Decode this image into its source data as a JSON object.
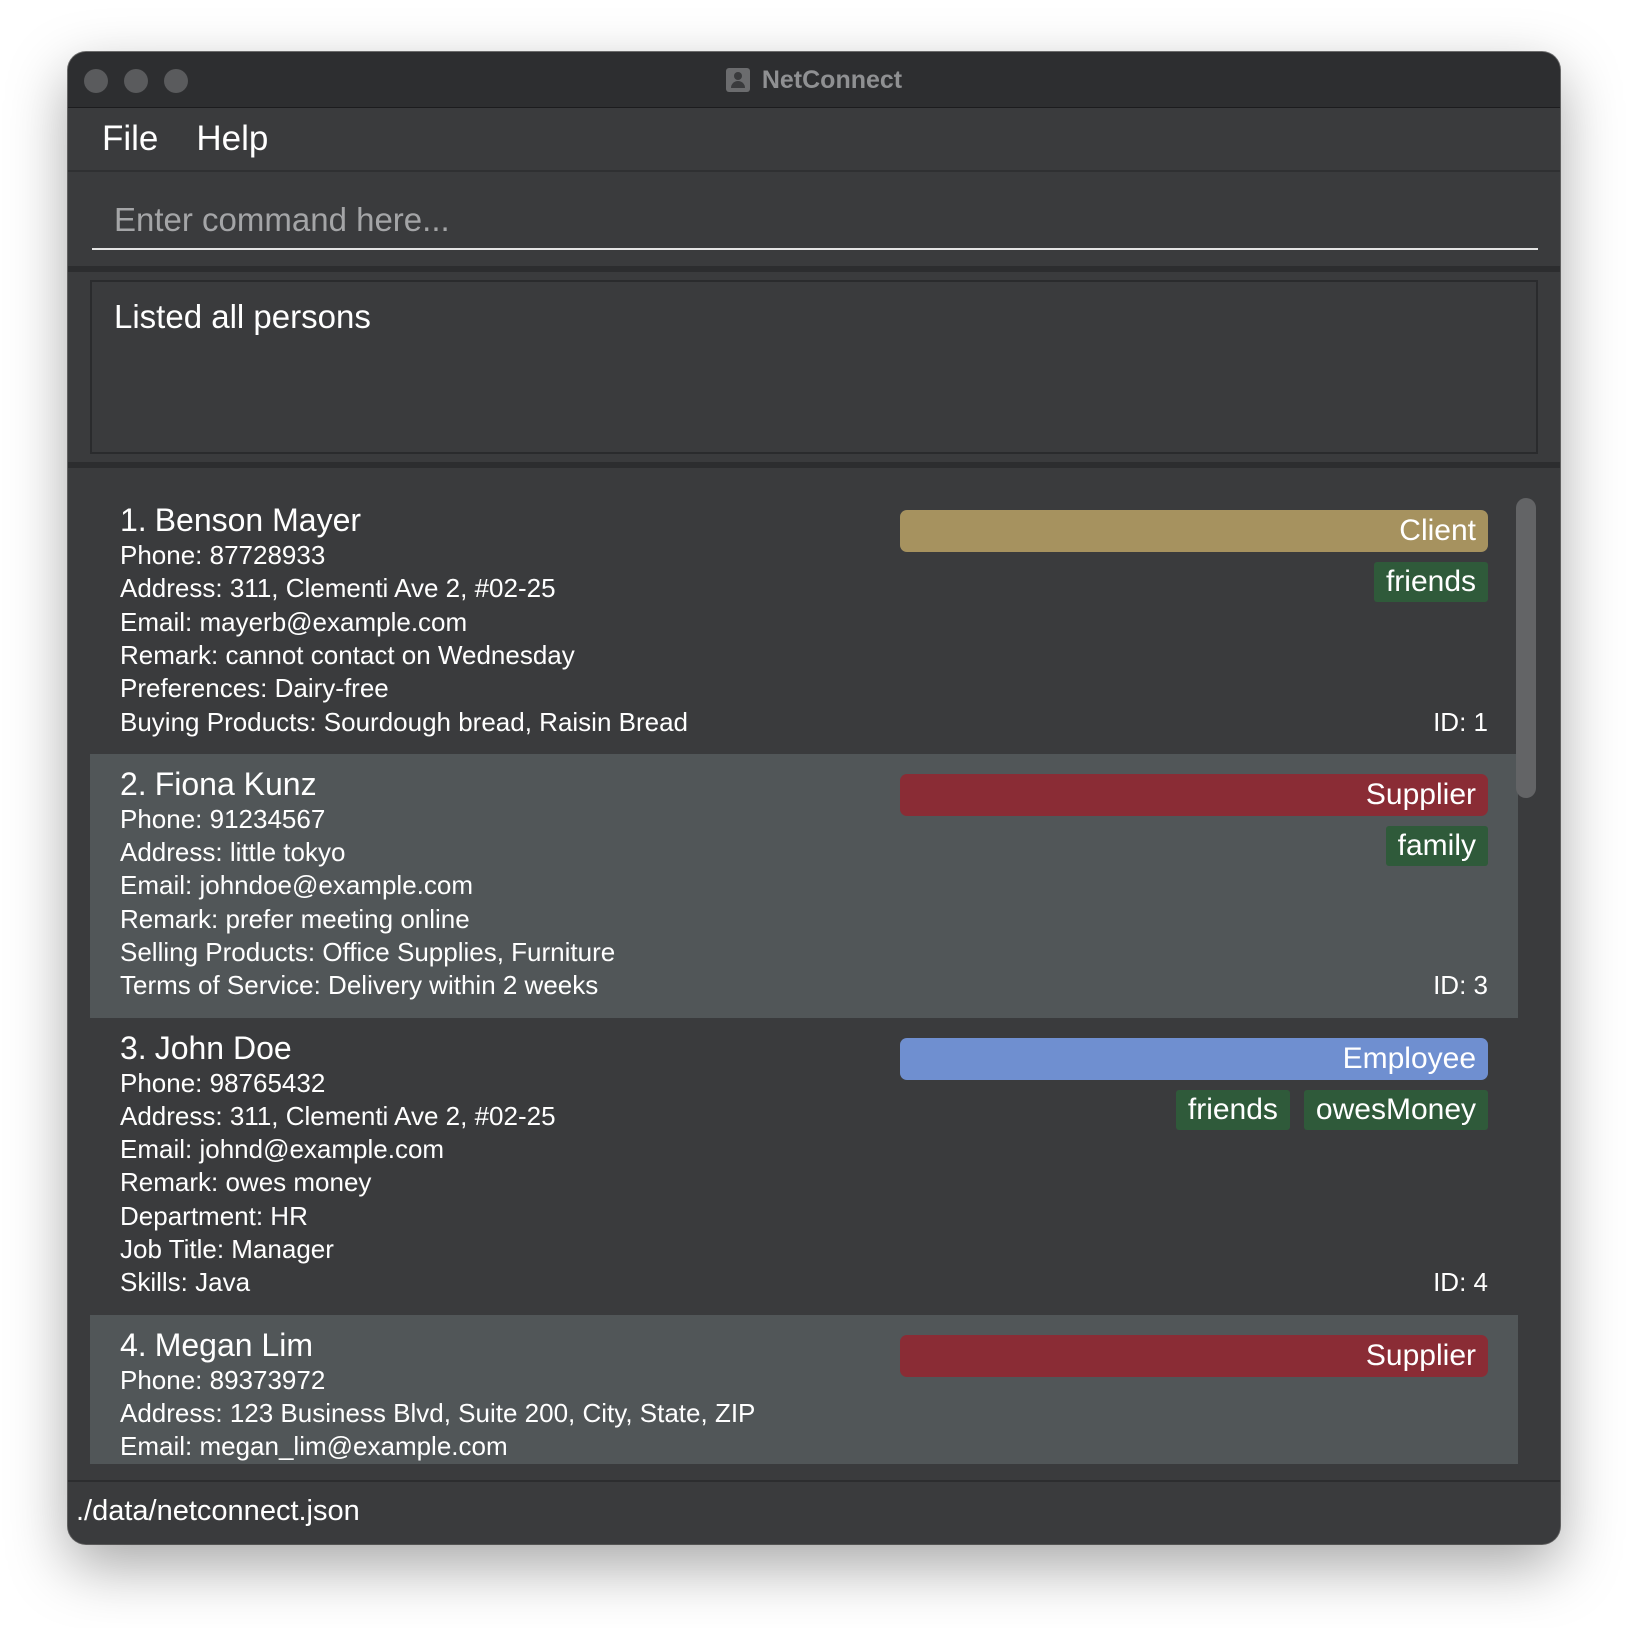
{
  "window": {
    "title": "NetConnect",
    "app_icon": "contact-card-icon"
  },
  "menu": {
    "file": "File",
    "help": "Help"
  },
  "command": {
    "placeholder": "Enter command here...",
    "value": ""
  },
  "result": {
    "message": "Listed all persons"
  },
  "colors": {
    "client": "#a6925f",
    "supplier": "#8a2c35",
    "employee": "#6f8fd0",
    "tag": "#2f5a3a"
  },
  "persons": [
    {
      "index": "1.",
      "name": "Benson Mayer",
      "role": "Client",
      "tags": [
        "friends"
      ],
      "fields": [
        "Phone: 87728933",
        "Address: 311, Clementi Ave 2, #02-25",
        "Email: mayerb@example.com",
        "Remark: cannot contact on Wednesday",
        "Preferences: Dairy-free",
        "Buying Products: Sourdough bread, Raisin Bread"
      ],
      "id": "ID: 1"
    },
    {
      "index": "2.",
      "name": "Fiona Kunz",
      "role": "Supplier",
      "tags": [
        "family"
      ],
      "fields": [
        "Phone: 91234567",
        "Address: little tokyo",
        "Email: johndoe@example.com",
        "Remark: prefer meeting online",
        "Selling Products: Office Supplies, Furniture",
        "Terms of Service: Delivery within 2 weeks"
      ],
      "id": "ID: 3"
    },
    {
      "index": "3.",
      "name": "John Doe",
      "role": "Employee",
      "tags": [
        "friends",
        "owesMoney"
      ],
      "fields": [
        "Phone: 98765432",
        "Address: 311, Clementi Ave 2, #02-25",
        "Email: johnd@example.com",
        "Remark: owes money",
        "Department: HR",
        "Job Title: Manager",
        "Skills: Java"
      ],
      "id": "ID: 4"
    },
    {
      "index": "4.",
      "name": "Megan Lim",
      "role": "Supplier",
      "tags": [],
      "fields": [
        "Phone: 89373972",
        "Address: 123 Business Blvd, Suite 200, City, State, ZIP",
        "Email: megan_lim@example.com"
      ],
      "id": ""
    }
  ],
  "status": {
    "file_path": "./data/netconnect.json"
  }
}
